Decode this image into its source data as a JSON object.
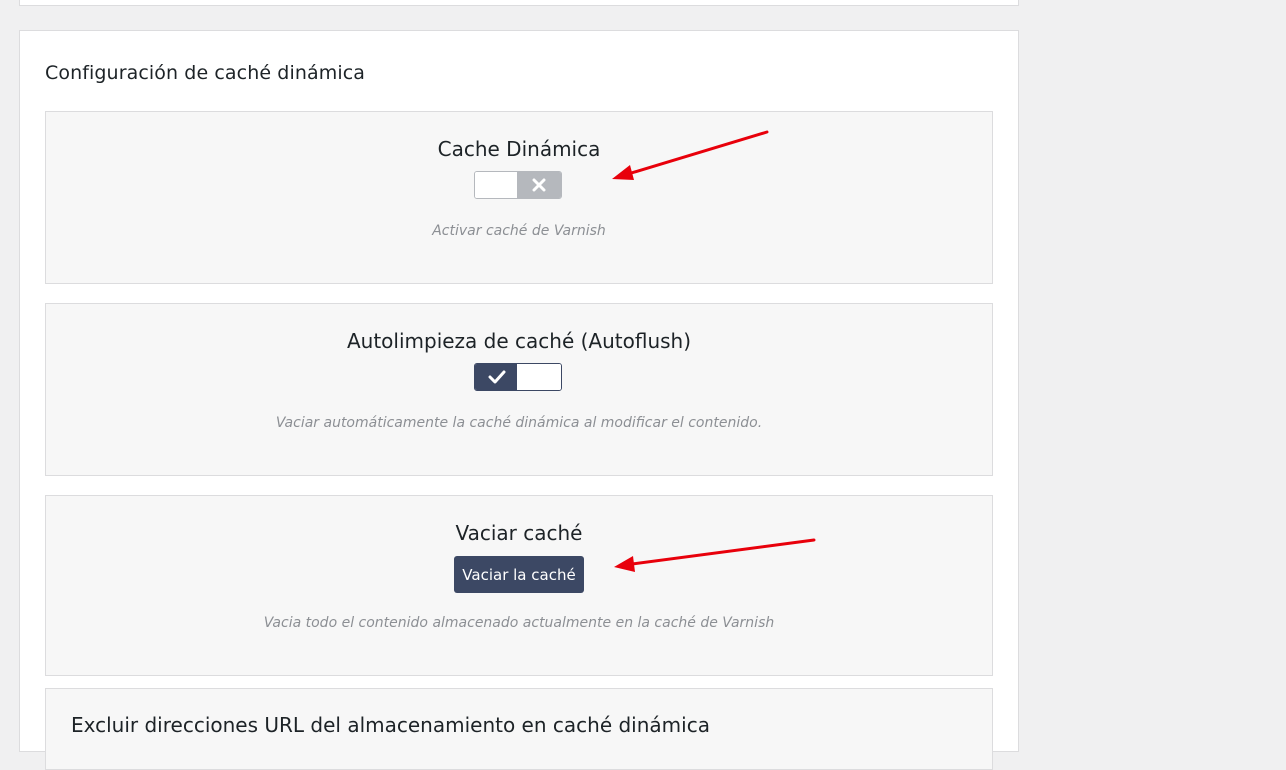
{
  "section": {
    "title": "Configuración de caché dinámica"
  },
  "dynamic_cache": {
    "title": "Cache Dinámica",
    "toggle_state": "off",
    "toggle_icon": "x-icon",
    "description": "Activar caché de Varnish"
  },
  "autoflush": {
    "title": "Autolimpieza de caché (Autoflush)",
    "toggle_state": "on",
    "toggle_icon": "check-icon",
    "description": "Vaciar automáticamente la caché dinámica al modificar el contenido."
  },
  "purge": {
    "title": "Vaciar caché",
    "button_label": "Vaciar la caché",
    "description": "Vacia todo el contenido almacenado actualmente en la caché de Varnish"
  },
  "exclude_urls": {
    "title": "Excluir direcciones URL del almacenamiento en caché dinámica"
  },
  "colors": {
    "accent": "#3c4864",
    "toggle_off": "#b5b8bd",
    "annotation_arrow": "#e8000b",
    "box_background": "#f7f7f7",
    "page_background": "#f0f0f1"
  }
}
